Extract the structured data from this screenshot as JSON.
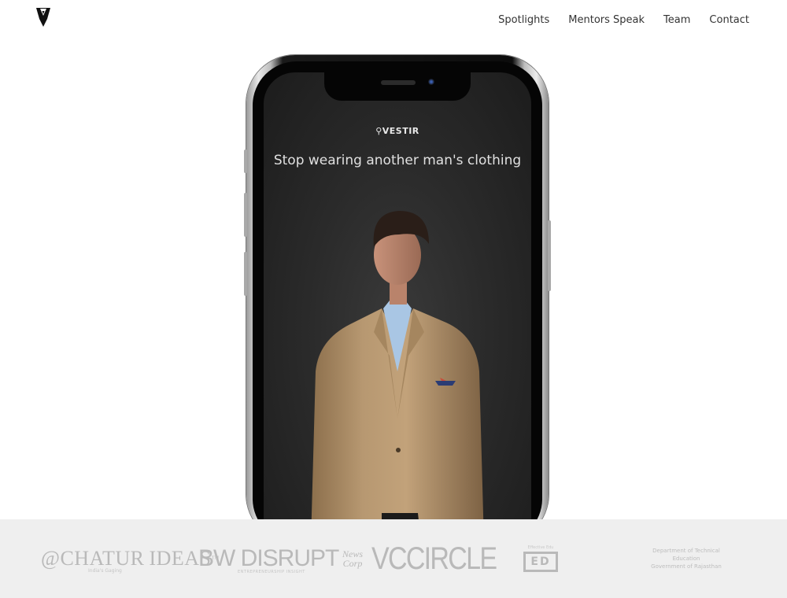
{
  "header": {
    "logo_icon": "vestir-tuxedo-logo-icon",
    "nav": [
      {
        "label": "Spotlights"
      },
      {
        "label": "Mentors Speak"
      },
      {
        "label": "Team"
      },
      {
        "label": "Contact"
      }
    ]
  },
  "hero": {
    "brand": "VESTIR",
    "tagline": "Stop wearing another man's clothing",
    "image_icon": "model-in-blazer-photo"
  },
  "partners": {
    "chatur": {
      "name_part1": "CHATUR",
      "name_part2": "IDEAS",
      "trademark": "™",
      "sub": "India's Gaging"
    },
    "bw": {
      "name": "BW DISRUPT",
      "sub": "ENTREPRENEURSHIP INSIGHT"
    },
    "vccircle": {
      "prefix_line1": "News",
      "prefix_line2": "Corp",
      "name": "VCCIRCLE"
    },
    "ed": {
      "top": "Effective Edu",
      "mark": "ED"
    },
    "dte": {
      "line1": "Department of Technical Education",
      "line2": "Government of Rajasthan"
    }
  },
  "colors": {
    "nav_text": "#333333",
    "partner_strip_bg": "#efefef",
    "partner_logo_gray": "#b9b9b9",
    "screen_bg": "#2b2b2b",
    "blazer": "#b4936b",
    "shirt": "#a9c6e4"
  }
}
